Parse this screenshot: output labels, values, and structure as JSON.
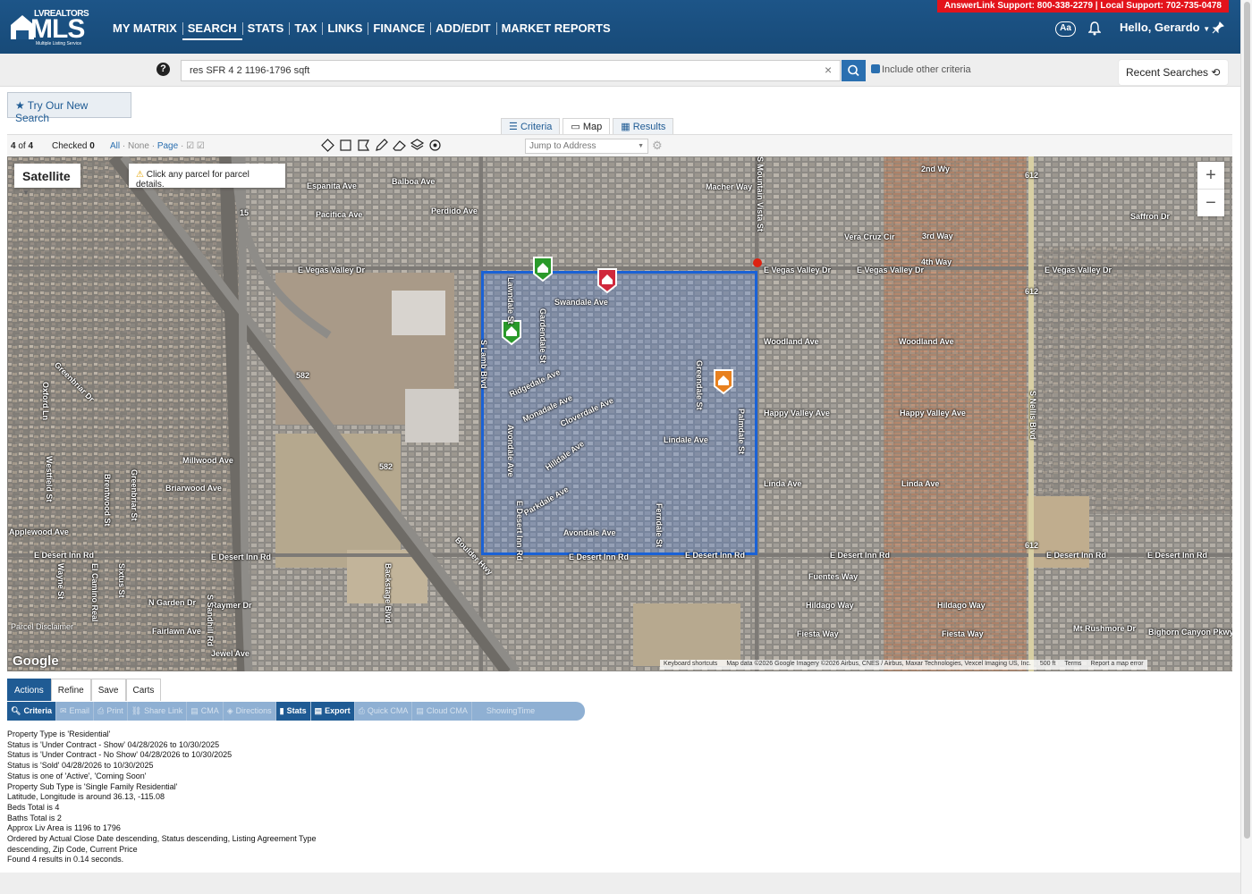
{
  "header": {
    "support": "AnswerLink Support: 800-338-2279 | Local Support: 702-735-0478",
    "logo": {
      "realtors": "LVREALTORS",
      "mls": "MLS",
      "sub": "Multiple Listing Service"
    },
    "nav": [
      "MY MATRIX",
      "SEARCH",
      "STATS",
      "TAX",
      "LINKS",
      "FINANCE",
      "ADD/EDIT",
      "MARKET REPORTS"
    ],
    "active_nav": "SEARCH",
    "aa": "Aa",
    "greeting": "Hello, Gerardo"
  },
  "search": {
    "help": "?",
    "query": "res SFR 4 2 1196-1796 sqft",
    "clear": "×",
    "include_label": "Include other criteria",
    "recent_label": "Recent Searches"
  },
  "try_new_search": "Try Our New Search",
  "view_tabs": [
    {
      "label": "Criteria",
      "icon": "sliders-icon"
    },
    {
      "label": "Map",
      "icon": "map-icon"
    },
    {
      "label": "Results",
      "icon": "grid-icon"
    }
  ],
  "toolbar": {
    "count_a": "4",
    "count_of": "of",
    "count_b": "4",
    "checked_label": "Checked",
    "checked_value": "0",
    "all": "All",
    "none": "None",
    "page": "Page",
    "jump_placeholder": "Jump to Address"
  },
  "map": {
    "layer": "Satellite",
    "tip": "Click any parcel for parcel details.",
    "zoom_in": "+",
    "zoom_out": "−",
    "google": "Google",
    "parcel_disclaimer": "Parcel Disclaimer",
    "footer": [
      "Keyboard shortcuts",
      "Map data ©2026 Google Imagery ©2026 Airbus, CNES / Airbus, Maxar Technologies, Vexcel Imaging US, Inc.",
      "500 ft",
      "Terms",
      "Report a map error"
    ],
    "streets": {
      "balboa": "Balboa Ave",
      "perdido": "Perdido Ave",
      "espanita": "Espanita Ave",
      "pacifica": "Pacifica Ave",
      "evegas_l": "E Vegas Valley Dr",
      "evegas_m": "E Vegas Valley Dr",
      "evegas_r1": "E Vegas Valley Dr",
      "evegas_r2": "E Vegas Valley Dr",
      "swandale": "Swandale Ave",
      "ridgedale": "Ridgedale Ave",
      "monadale": "Monadale Ave",
      "cloverdale": "Cloverdale Ave",
      "hilldale": "Hilldale Ave",
      "parkdale": "Parkdale Ave",
      "avondale": "Avondale Ave",
      "lindale": "Lindale Ave",
      "woodland_l": "Woodland Ave",
      "woodland_r": "Woodland Ave",
      "happy_l": "Happy Valley Ave",
      "happy_r": "Happy Valley Ave",
      "linda_l": "Linda Ave",
      "linda_r": "Linda Ave",
      "millwood": "Millwood Ave",
      "briarwood": "Briarwood Ave",
      "applewood": "Applewood Ave",
      "desert_1": "E Desert Inn Rd",
      "desert_2": "E Desert Inn Rd",
      "desert_3": "E Desert Inn Rd",
      "desert_4": "E Desert Inn Rd",
      "desert_5": "E Desert Inn Rd",
      "desert_6": "E Desert Inn Rd",
      "desert_7": "E Desert Inn Rd",
      "fuentes": "Fuentes Way",
      "hildago_l": "Hildago Way",
      "hildago_r": "Hildago Way",
      "fiesta_l": "Fiesta Way",
      "fiesta_r": "Fiesta Way",
      "mtrush": "Mt Rushmore Dr",
      "bighorn": "Bighorn Canyon Pkwy",
      "saffron": "Saffron Dr",
      "vera": "Vera Cruz Cir",
      "fourth": "4th Way",
      "third": "3rd Way",
      "second": "2nd Wy",
      "macher": "Macher Way",
      "ngarden": "N Garden Dr",
      "raymer": "Raymer Dr",
      "fairlawn": "Fairlawn Ave",
      "jewel": "Jewel Ave",
      "boulder": "Boulder Hwy",
      "snellis": "S Nellis Blvd",
      "slamb": "S Lamb Blvd",
      "smtn": "S Mountain Vista St",
      "sandhill": "S Sandhill Rd",
      "palmdale": "Palmdale St",
      "fenndale": "Ferndale St",
      "greendale": "Greendale St",
      "gardendale": "Gardendale St",
      "lawndale": "Lawndale St",
      "avondale_st": "Avondale Ave",
      "edesert_inn": "E Desert Inn Rd",
      "backstage": "Backstage Blvd",
      "elcamino": "El Camino Real",
      "wayne": "Wayne St",
      "westfield": "Westfield St",
      "oxford": "Oxford Ln",
      "greenbriar": "Greenbriar Dr",
      "brentwood": "Brentwood St",
      "greenbriar_st": "Greenbriar St",
      "sixtus": "Sixtus St",
      "route582a": "582",
      "route582b": "582",
      "route612a": "612",
      "route612b": "612",
      "route612c": "612",
      "route15": "15"
    }
  },
  "action_tabs": [
    "Actions",
    "Refine",
    "Save",
    "Carts"
  ],
  "action_buttons": [
    {
      "label": "Criteria",
      "icon": "search-icon",
      "state": "on"
    },
    {
      "label": "Email",
      "icon": "email-icon",
      "state": "off"
    },
    {
      "label": "Print",
      "icon": "print-icon",
      "state": "off"
    },
    {
      "label": "Share Link",
      "icon": "link-icon",
      "state": "off"
    },
    {
      "label": "CMA",
      "icon": "cma-icon",
      "state": "off"
    },
    {
      "label": "Directions",
      "icon": "directions-icon",
      "state": "off"
    },
    {
      "label": "Stats",
      "icon": "stats-icon",
      "state": "on"
    },
    {
      "label": "Export",
      "icon": "export-icon",
      "state": "on"
    },
    {
      "label": "Quick CMA",
      "icon": "quick-cma-icon",
      "state": "off"
    },
    {
      "label": "Cloud CMA",
      "icon": "cloud-cma-icon",
      "state": "off"
    },
    {
      "label": "ShowingTime",
      "icon": "",
      "state": "off"
    }
  ],
  "criteria_lines": [
    "Property Type is 'Residential'",
    "Status is 'Under Contract - Show' 04/28/2026 to 10/30/2025",
    "Status is 'Under Contract - No Show' 04/28/2026 to 10/30/2025",
    "Status is 'Sold' 04/28/2026 to 10/30/2025",
    "Status is one of 'Active', 'Coming Soon'",
    "Property Sub Type is 'Single Family Residential'",
    "Latitude, Longitude is around 36.13, -115.08",
    "Beds Total is 4",
    "Baths Total is 2",
    "Approx Liv Area is 1196 to 1796",
    "Ordered by Actual Close Date descending, Status descending, Listing Agreement Type",
    "descending, Zip Code, Current Price",
    "Found 4 results in 0.14 seconds."
  ],
  "colors": {
    "header": "#1d5588",
    "support": "#e3131b",
    "accent": "#1f5b94",
    "region": "#1a62d6",
    "marker_green": "#2a9a2a",
    "marker_red": "#d0283c",
    "marker_orange": "#e8801e"
  }
}
